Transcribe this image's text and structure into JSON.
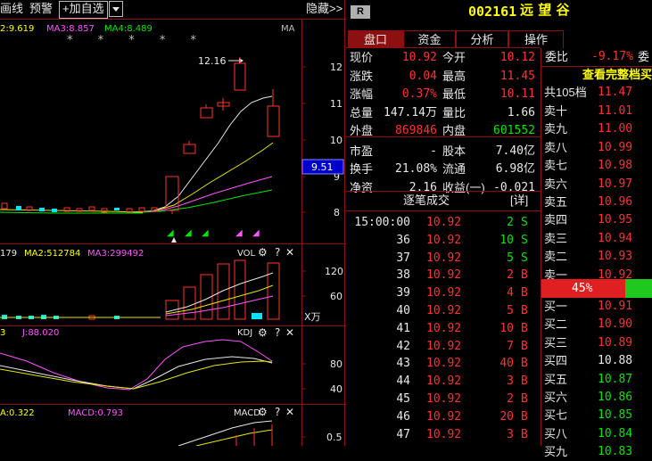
{
  "toolbar": {
    "chart_label": "画线",
    "alert_label": "预警",
    "add_watch_label": "+加自选",
    "hide_label": "隐藏>>"
  },
  "header": {
    "badge": "R",
    "stock_code": "002161",
    "stock_name": "远 望 谷"
  },
  "tabs": [
    "盘口",
    "资金",
    "分析",
    "操作"
  ],
  "main_chart": {
    "ma_labels": [
      "2:9.619",
      "MA3:8.857",
      "MA4:8.489",
      "MA"
    ],
    "price_ticks": [
      "12",
      "11",
      "10",
      "9",
      "8"
    ],
    "high_label": "12.16",
    "cursor_value": "9.51",
    "stars": "* * * * *"
  },
  "vol_chart": {
    "labels": [
      "179",
      "MA2:512784",
      "MA3:299492",
      "VOL"
    ],
    "ticks": [
      "120",
      "60"
    ],
    "unit": "X万"
  },
  "kdj_chart": {
    "labels": [
      "3",
      "J:88.020",
      "KDJ"
    ],
    "ticks": [
      "80",
      "40"
    ]
  },
  "macd_chart": {
    "labels": [
      "A:0.322",
      "MACD:0.793",
      "MACD"
    ],
    "ticks": [
      "0.5"
    ]
  },
  "quote": [
    {
      "l1": "现价",
      "v1": "10.92",
      "c1": "red",
      "l2": "今开",
      "v2": "10.12",
      "c2": "red"
    },
    {
      "l1": "涨跌",
      "v1": "0.04",
      "c1": "red",
      "l2": "最高",
      "v2": "11.45",
      "c2": "red"
    },
    {
      "l1": "涨幅",
      "v1": "0.37%",
      "c1": "red",
      "l2": "最低",
      "v2": "10.11",
      "c2": "red"
    },
    {
      "l1": "总量",
      "v1": "147.14万",
      "c1": "white",
      "l2": "量比",
      "v2": "1.66",
      "c2": "white"
    },
    {
      "l1": "外盘",
      "v1": "869846",
      "c1": "red",
      "l2": "内盘",
      "v2": "601552",
      "c2": "green"
    },
    {
      "l1": "市盈",
      "v1": "-",
      "c1": "white",
      "l2": "股本",
      "v2": "7.40亿",
      "c2": "white"
    },
    {
      "l1": "换手",
      "v1": "21.08%",
      "c1": "white",
      "l2": "流通",
      "v2": "6.98亿",
      "c2": "white"
    },
    {
      "l1": "净资",
      "v1": "2.16",
      "c1": "white",
      "l2": "收益(一)",
      "v2": "-0.021",
      "c2": "white"
    }
  ],
  "ticks_panel": {
    "title": "逐笔成交",
    "detail": "[详]",
    "rows": [
      {
        "t": "15:00:00",
        "p": "10.92",
        "v": "2",
        "s": "S"
      },
      {
        "t": "36",
        "p": "10.92",
        "v": "10",
        "s": "S"
      },
      {
        "t": "37",
        "p": "10.92",
        "v": "5",
        "s": "S"
      },
      {
        "t": "38",
        "p": "10.92",
        "v": "2",
        "s": "B"
      },
      {
        "t": "39",
        "p": "10.92",
        "v": "4",
        "s": "B"
      },
      {
        "t": "40",
        "p": "10.92",
        "v": "5",
        "s": "B"
      },
      {
        "t": "41",
        "p": "10.92",
        "v": "10",
        "s": "B"
      },
      {
        "t": "42",
        "p": "10.92",
        "v": "7",
        "s": "B"
      },
      {
        "t": "43",
        "p": "10.92",
        "v": "40",
        "s": "B"
      },
      {
        "t": "44",
        "p": "10.92",
        "v": "3",
        "s": "B"
      },
      {
        "t": "45",
        "p": "10.92",
        "v": "2",
        "s": "B"
      },
      {
        "t": "46",
        "p": "10.92",
        "v": "20",
        "s": "B"
      },
      {
        "t": "47",
        "p": "10.92",
        "v": "3",
        "s": "B"
      }
    ]
  },
  "orderbook": {
    "weibi_label": "委比",
    "weibi_value": "-9.17%",
    "weicha_label": "委",
    "full_label": "查看完整档买",
    "total_label": "共105档",
    "total_price": "11.47",
    "sell": [
      {
        "label": "卖十",
        "price": "11.01",
        "color": "red"
      },
      {
        "label": "卖九",
        "price": "11.00",
        "color": "red"
      },
      {
        "label": "卖八",
        "price": "10.99",
        "color": "red"
      },
      {
        "label": "卖七",
        "price": "10.98",
        "color": "red"
      },
      {
        "label": "卖六",
        "price": "10.97",
        "color": "red"
      },
      {
        "label": "卖五",
        "price": "10.96",
        "color": "red"
      },
      {
        "label": "卖四",
        "price": "10.95",
        "color": "red"
      },
      {
        "label": "卖三",
        "price": "10.94",
        "color": "red"
      },
      {
        "label": "卖二",
        "price": "10.93",
        "color": "red"
      },
      {
        "label": "卖一",
        "price": "10.92",
        "color": "red"
      }
    ],
    "ratio": "45%",
    "buy": [
      {
        "label": "买一",
        "price": "10.91",
        "color": "red"
      },
      {
        "label": "买二",
        "price": "10.90",
        "color": "red"
      },
      {
        "label": "买三",
        "price": "10.89",
        "color": "red"
      },
      {
        "label": "买四",
        "price": "10.88",
        "color": "white"
      },
      {
        "label": "买五",
        "price": "10.87",
        "color": "green"
      },
      {
        "label": "买六",
        "price": "10.86",
        "color": "green"
      },
      {
        "label": "买七",
        "price": "10.85",
        "color": "green"
      },
      {
        "label": "买八",
        "price": "10.84",
        "color": "green"
      },
      {
        "label": "买九",
        "price": "10.83",
        "color": "green"
      }
    ]
  }
}
